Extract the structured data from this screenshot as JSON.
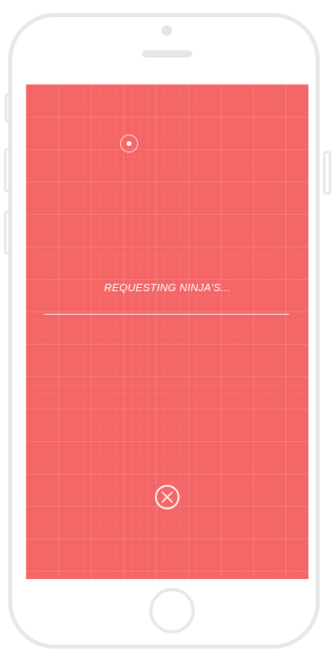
{
  "app": {
    "status_text": "REQUESTING NINJA'S..."
  },
  "icons": {
    "radar": "radar-location-icon",
    "cancel": "close-circle-icon"
  },
  "colors": {
    "screen_background": "#f46565",
    "foreground": "#ffffff",
    "device_frame": "#e8e8e8"
  }
}
